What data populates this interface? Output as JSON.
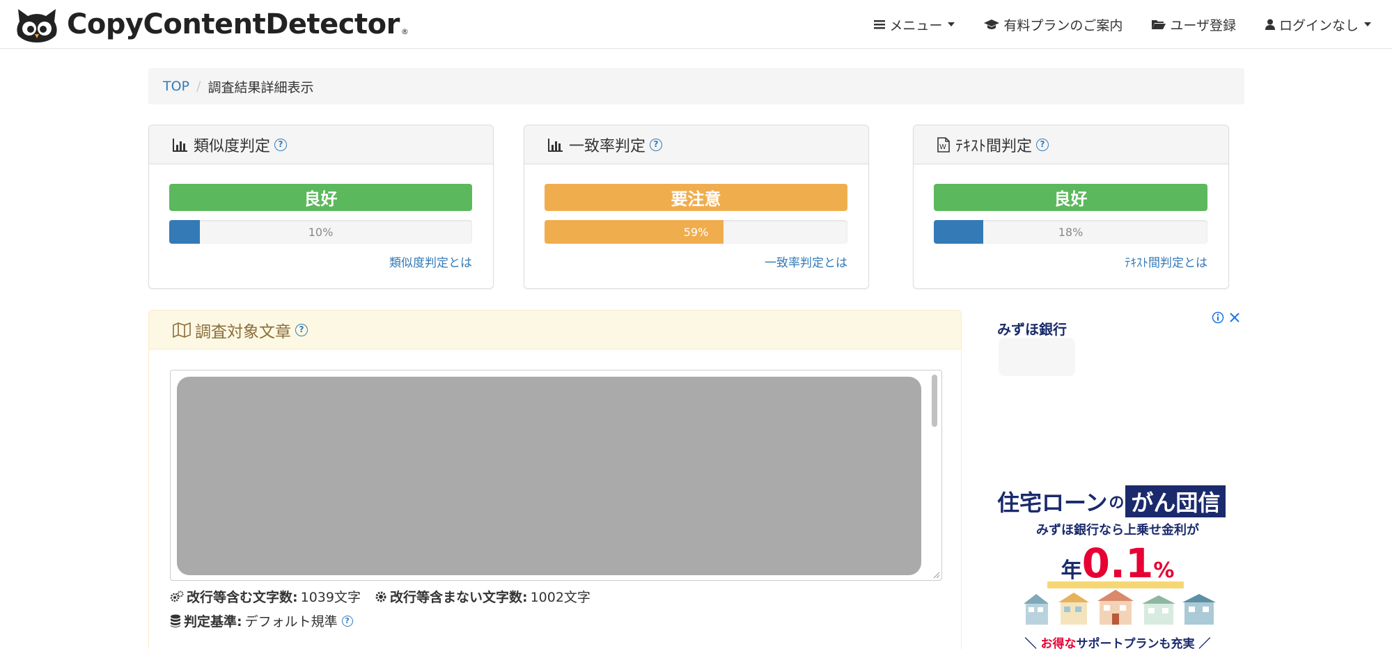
{
  "navbar": {
    "brand": "CopyContentDetector",
    "brand_reg": "®",
    "menu": "メニュー",
    "paid_plan": "有料プランのご案内",
    "register": "ユーザ登録",
    "login": "ログインなし"
  },
  "breadcrumb": {
    "top": "TOP",
    "sep": "/",
    "current": "調査結果詳細表示"
  },
  "panels": [
    {
      "title": "類似度判定",
      "verdict": "良好",
      "progress_percent": 10,
      "progress_label": "10%",
      "link": "類似度判定とは",
      "verdict_color": "#5cb85c",
      "bar_color": "#337ab7"
    },
    {
      "title": "一致率判定",
      "verdict": "要注意",
      "progress_percent": 59,
      "progress_label": "59%",
      "link": "一致率判定とは",
      "verdict_color": "#f0ad4e",
      "bar_color": "#f0ad4e"
    },
    {
      "title": "ﾃｷｽﾄ間判定",
      "verdict": "良好",
      "progress_percent": 18,
      "progress_label": "18%",
      "link": "ﾃｷｽﾄ間判定とは",
      "verdict_color": "#5cb85c",
      "bar_color": "#337ab7"
    }
  ],
  "help_mark": "?",
  "target": {
    "title": "調査対象文章",
    "chars_with_breaks_label": "改行等含む文字数:",
    "chars_with_breaks_value": "1039文字",
    "chars_without_breaks_label": "改行等含まない文字数:",
    "chars_without_breaks_value": "1002文字",
    "criteria_label": "判定基準:",
    "criteria_value": "デフォルト規準"
  },
  "ad": {
    "bank": "みずほ銀行",
    "headline_a": "住宅ローン",
    "headline_no": "の",
    "headline_b": "がん団信",
    "sub": "みずほ銀行なら上乗せ金利が",
    "rate_year": "年",
    "rate_num": "0.1",
    "rate_pct": "%",
    "foot_a": "＼ ",
    "foot_red": "お得な",
    "foot_b": "サポートプランも充実 ／"
  },
  "colors": {
    "link": "#337ab7",
    "success": "#5cb85c",
    "warning": "#f0ad4e",
    "target_bg": "#fcf8e3",
    "target_text": "#8a6d3b"
  }
}
